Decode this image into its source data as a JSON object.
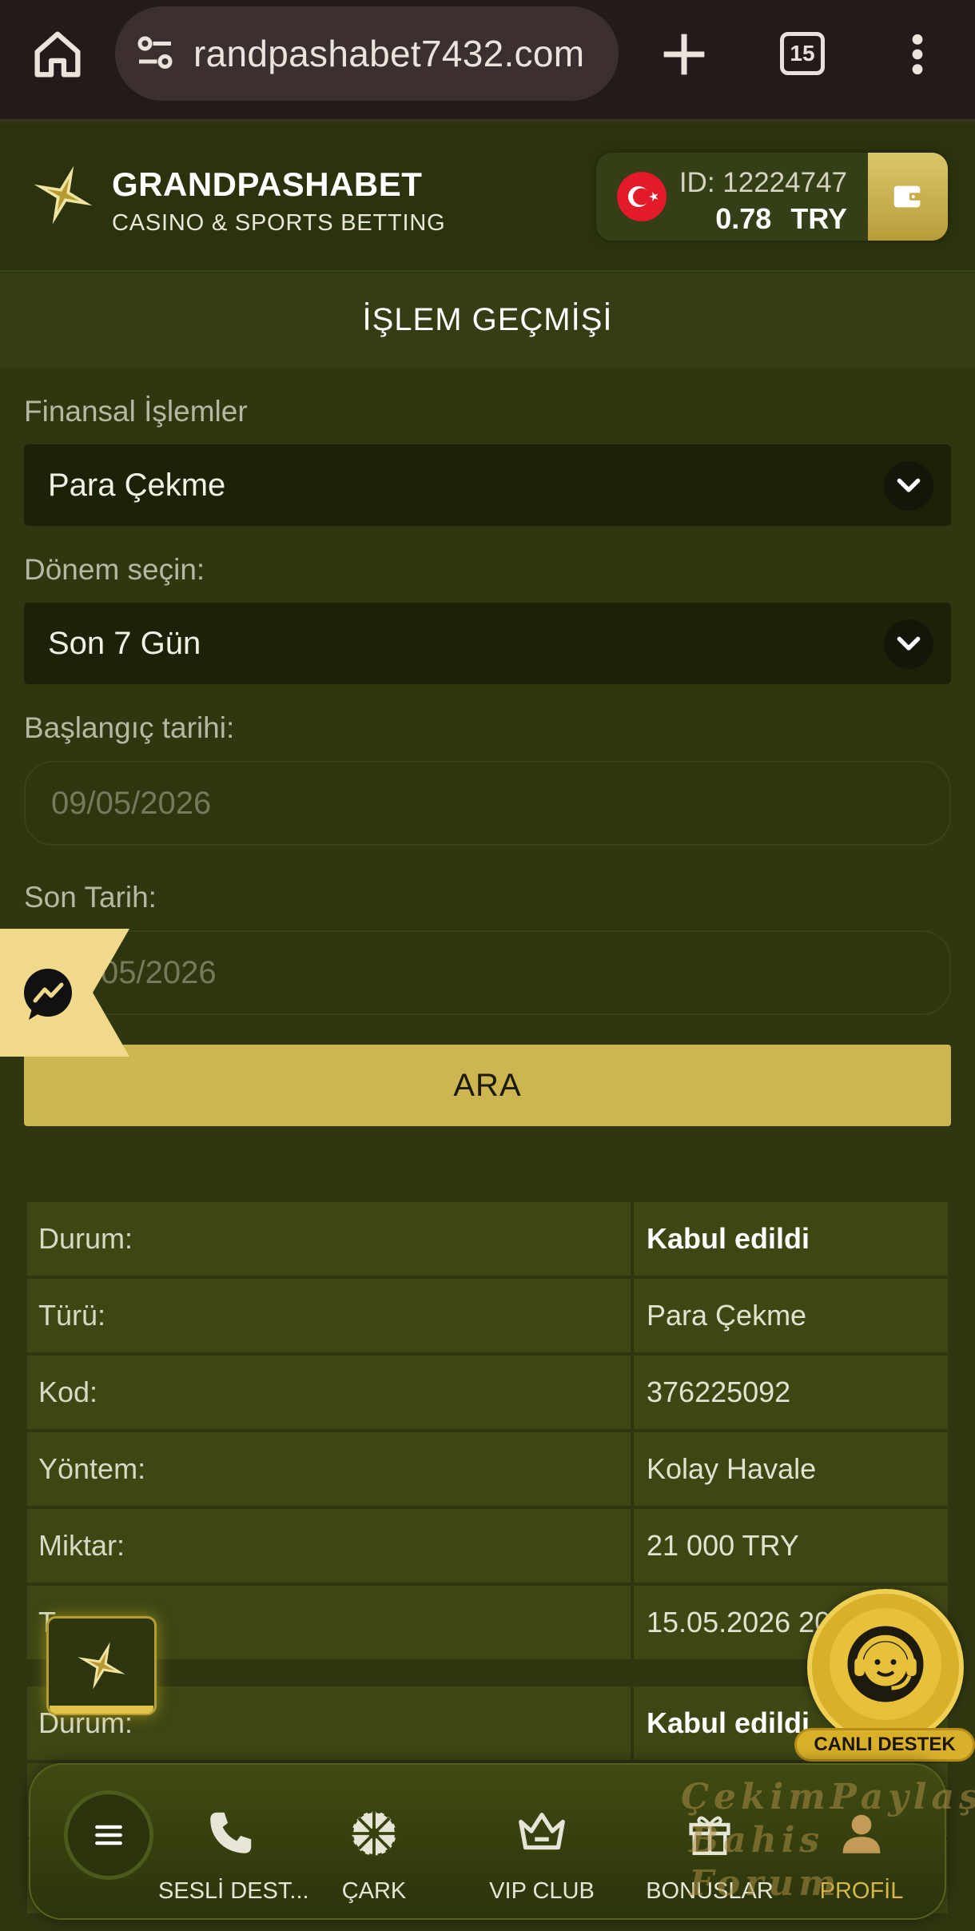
{
  "browser": {
    "url": "randpashabet7432.com",
    "tab_count": "15",
    "icons": [
      "home-icon",
      "site-settings-icon",
      "new-tab-icon",
      "tab-switcher-icon",
      "menu-dots-icon"
    ]
  },
  "header": {
    "brand_name": "GRANDPASHABET",
    "brand_tagline": "CASINO & SPORTS BETTING",
    "account_id": "ID: 12224747",
    "balance": "0.78",
    "currency": "TRY"
  },
  "page": {
    "title": "İŞLEM GEÇMİŞİ"
  },
  "filters": {
    "type_label": "Finansal İşlemler",
    "type_value": "Para Çekme",
    "period_label": "Dönem seçin:",
    "period_value": "Son 7 Gün",
    "start_label": "Başlangıç tarihi:",
    "start_value": "09/05/2026",
    "end_label": "Son Tarih:",
    "end_value": "05/2026",
    "search_label": "ARA"
  },
  "transactions": [
    {
      "rows": [
        {
          "label": "Durum:",
          "value": "Kabul edildi",
          "bold": true
        },
        {
          "label": "Türü:",
          "value": "Para Çekme"
        },
        {
          "label": "Kod:",
          "value": "376225092"
        },
        {
          "label": "Yöntem:",
          "value": "Kolay Havale"
        },
        {
          "label": "Miktar:",
          "value": "21 000 TRY"
        },
        {
          "label": "T",
          "value": "15.05.2026 20"
        }
      ]
    },
    {
      "rows": [
        {
          "label": "Durum:",
          "value": "Kabul edildi",
          "bold": true
        }
      ]
    }
  ],
  "support": {
    "label": "CANLI DESTEK"
  },
  "bottom_nav": {
    "items": [
      {
        "label": "SESLİ DEST...",
        "icon": "phone-icon"
      },
      {
        "label": "ÇARK",
        "icon": "wheel-icon"
      },
      {
        "label": "VIP CLUB",
        "icon": "crown-icon"
      },
      {
        "label": "BONUSLAR",
        "icon": "gift-icon"
      },
      {
        "label": "PROFİL",
        "icon": "user-icon"
      }
    ]
  },
  "watermark": {
    "line1": "ÇekimPaylaş",
    "line2": "Bahis Forum"
  },
  "colors": {
    "background": "#2f3711",
    "accent_gold": "#cdb651",
    "active_nav": "#d5b847"
  }
}
